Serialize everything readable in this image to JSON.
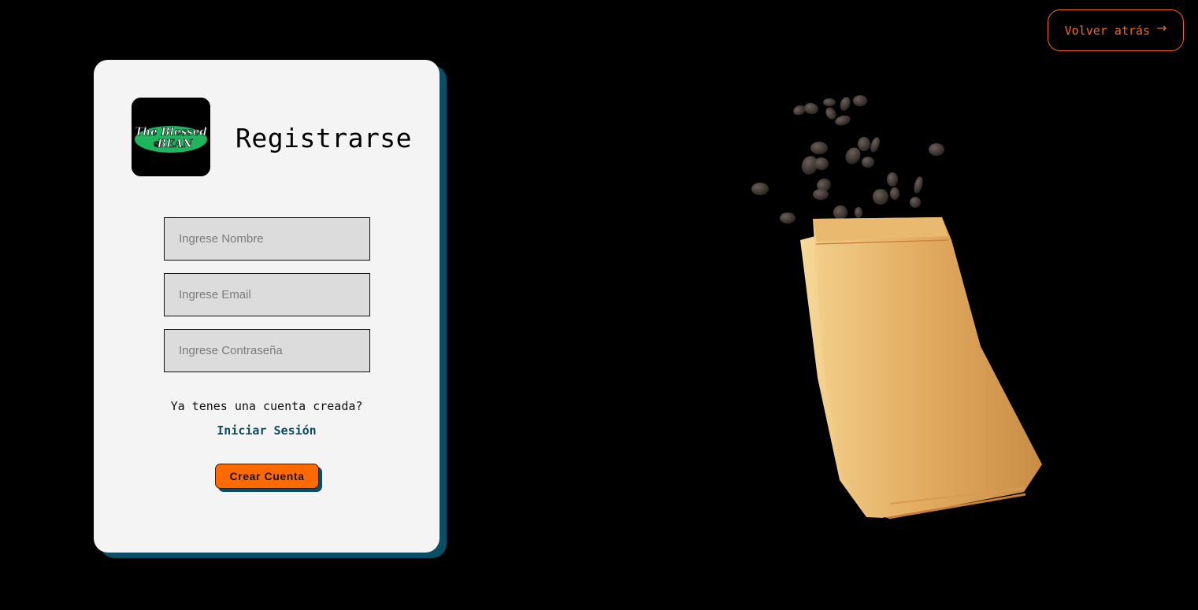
{
  "header": {
    "back_label": "Volver atrás",
    "back_icon": "arrow-right-icon"
  },
  "brand": {
    "logo_line1": "The Blessed",
    "logo_line2": "BEAN",
    "logo_icon": "coffee-bean-icon"
  },
  "form": {
    "title": "Registrarse",
    "name_placeholder": "Ingrese Nombre",
    "email_placeholder": "Ingrese Email",
    "password_placeholder": "Ingrese Contraseña",
    "question": "Ya tenes una cuenta creada?",
    "login_link": "Iniciar Sesión",
    "submit_label": "Crear Cuenta"
  },
  "colors": {
    "background": "#000000",
    "card": "#f4f4f4",
    "accent_orange": "#ff6a00",
    "accent_teal": "#0b4d64",
    "logo_green": "#1fb45e"
  },
  "hero": {
    "image": "coffee-bag-with-beans"
  }
}
